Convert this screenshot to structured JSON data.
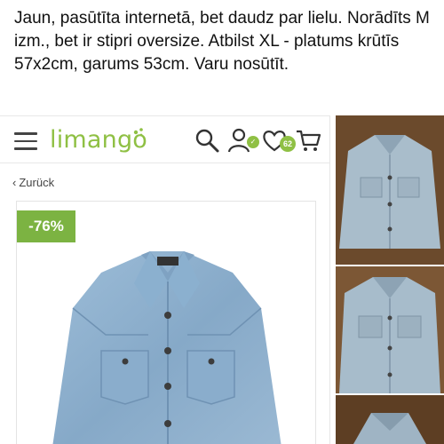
{
  "post": {
    "text": "Jaun, pasūtīta internetā, bet daudz par lielu. Norādīts M izm., bet ir stipri oversize. Atbilst XL - platums krūtīs 57x2cm, garums 53cm. Varu nosūtīt."
  },
  "shop": {
    "logo": "limango",
    "wishlist_count": "62",
    "back_label": "Zurück",
    "discount": "-76%"
  },
  "icons": [
    "menu-icon",
    "search-icon",
    "account-icon",
    "wishlist-icon",
    "cart-icon",
    "chevron-left-icon"
  ],
  "colors": {
    "brand_green": "#8fc044",
    "discount_badge": "#7cb342",
    "denim": "#8fb2cf"
  }
}
